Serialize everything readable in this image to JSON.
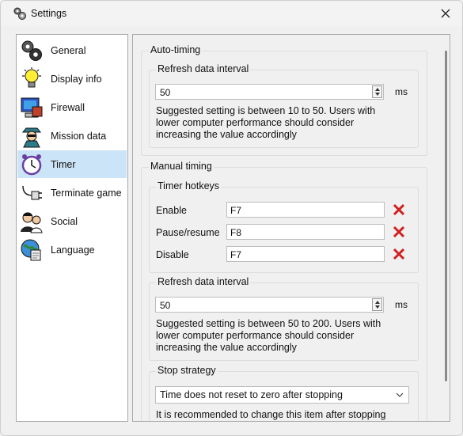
{
  "window": {
    "title": "Settings"
  },
  "sidebar": {
    "items": [
      {
        "label": "General",
        "icon": "gears-icon"
      },
      {
        "label": "Display info",
        "icon": "lightbulb-icon"
      },
      {
        "label": "Firewall",
        "icon": "firewall-computer-icon"
      },
      {
        "label": "Mission data",
        "icon": "spy-icon"
      },
      {
        "label": "Timer",
        "icon": "alarm-clock-icon",
        "selected": true
      },
      {
        "label": "Terminate game",
        "icon": "plug-icon"
      },
      {
        "label": "Social",
        "icon": "people-icon"
      },
      {
        "label": "Language",
        "icon": "globe-document-icon"
      }
    ]
  },
  "auto_timing": {
    "title": "Auto-timing",
    "refresh": {
      "title": "Refresh data interval",
      "value": "50",
      "unit": "ms",
      "desc_lines": [
        "Suggested setting is between 10 to 50. Users with",
        "lower computer performance should consider",
        "increasing the value accordingly"
      ]
    }
  },
  "manual_timing": {
    "title": "Manual timing",
    "hotkeys": {
      "title": "Timer hotkeys",
      "rows": [
        {
          "label": "Enable",
          "value": "F7"
        },
        {
          "label": "Pause/resume",
          "value": "F8"
        },
        {
          "label": "Disable",
          "value": "F7"
        }
      ]
    },
    "refresh": {
      "title": "Refresh data interval",
      "value": "50",
      "unit": "ms",
      "desc_lines": [
        "Suggested setting is between 50 to 200. Users with",
        "lower computer performance should consider",
        "increasing the value accordingly"
      ]
    },
    "stop_strategy": {
      "title": "Stop strategy",
      "selected": "Time does not reset to zero after stopping",
      "desc_lines": [
        "It is recommended to change this item after stopping"
      ]
    }
  },
  "colors": {
    "selection": "#cce4f7",
    "remove_x": "#d21f1f"
  }
}
